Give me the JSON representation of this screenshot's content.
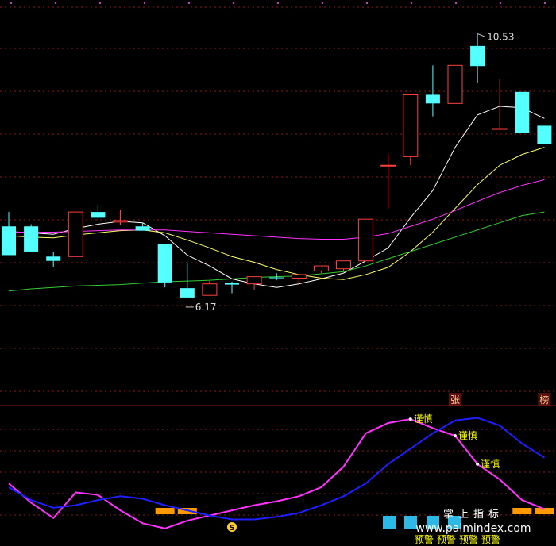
{
  "colors": {
    "background": "#000000",
    "grid": "#8b1a1a",
    "up_candle": "#ff4040",
    "down_candle": "#54ffff",
    "ma5": "#ffffff",
    "ma10": "#ffff66",
    "ma20": "#ff33ff",
    "ma60": "#33cc33",
    "osc_fast": "#ff33ff",
    "osc_slow": "#1f1fff",
    "signal_bar": "#ff9900",
    "caution_text": "#ffff00",
    "badge_bg": "#5a1010",
    "badge_text": "#ffcc99"
  },
  "chart_data": [
    {
      "type": "candlestick",
      "title": "",
      "ylim": [
        5.7,
        10.8
      ],
      "grid": true,
      "candles": [
        {
          "o": 7.85,
          "h": 8.05,
          "l": 7.45,
          "c": 7.45
        },
        {
          "o": 7.85,
          "h": 7.88,
          "l": 7.5,
          "c": 7.5
        },
        {
          "o": 7.43,
          "h": 7.5,
          "l": 7.28,
          "c": 7.37
        },
        {
          "o": 7.43,
          "h": 8.05,
          "l": 7.43,
          "c": 8.05
        },
        {
          "o": 8.05,
          "h": 8.15,
          "l": 7.94,
          "c": 7.97
        },
        {
          "o": 7.91,
          "h": 8.08,
          "l": 7.87,
          "c": 7.93
        },
        {
          "o": 7.85,
          "h": 7.9,
          "l": 7.8,
          "c": 7.79
        },
        {
          "o": 7.6,
          "h": 7.6,
          "l": 7.0,
          "c": 7.07
        },
        {
          "o": 6.99,
          "h": 7.35,
          "l": 6.85,
          "c": 6.86
        },
        {
          "o": 6.89,
          "h": 7.09,
          "l": 6.89,
          "c": 7.05
        },
        {
          "o": 7.06,
          "h": 7.08,
          "l": 6.92,
          "c": 7.04
        },
        {
          "o": 7.05,
          "h": 7.15,
          "l": 6.97,
          "c": 7.15
        },
        {
          "o": 7.14,
          "h": 7.2,
          "l": 7.1,
          "c": 7.13
        },
        {
          "o": 7.13,
          "h": 7.14,
          "l": 7.05,
          "c": 7.18
        },
        {
          "o": 7.23,
          "h": 7.3,
          "l": 7.2,
          "c": 7.3
        },
        {
          "o": 7.26,
          "h": 7.37,
          "l": 7.23,
          "c": 7.37
        },
        {
          "o": 7.37,
          "h": 7.37,
          "l": 7.37,
          "c": 7.95
        },
        {
          "o": 8.7,
          "h": 8.85,
          "l": 8.1,
          "c": 8.7
        },
        {
          "o": 8.82,
          "h": 9.68,
          "l": 8.7,
          "c": 9.68
        },
        {
          "o": 9.68,
          "h": 10.09,
          "l": 9.38,
          "c": 9.56
        },
        {
          "o": 9.56,
          "h": 10.09,
          "l": 9.56,
          "c": 10.09
        },
        {
          "o": 10.36,
          "h": 10.53,
          "l": 9.85,
          "c": 10.08
        },
        {
          "o": 9.2,
          "h": 9.9,
          "l": 9.2,
          "c": 9.21
        },
        {
          "o": 9.72,
          "h": 9.72,
          "l": 9.15,
          "c": 9.15
        },
        {
          "o": 9.25,
          "h": 9.25,
          "l": 9.0,
          "c": 9.0
        }
      ],
      "moving_averages": [
        {
          "name": "MA5",
          "values": [
            7.78,
            7.76,
            7.74,
            7.82,
            7.88,
            7.92,
            7.9,
            7.72,
            7.45,
            7.3,
            7.12,
            7.05,
            7.0,
            7.05,
            7.12,
            7.2,
            7.37,
            7.55,
            7.97,
            8.35,
            8.95,
            9.4,
            9.52,
            9.5,
            9.35
          ]
        },
        {
          "name": "MA10",
          "values": [
            7.72,
            7.7,
            7.69,
            7.73,
            7.76,
            7.79,
            7.8,
            7.76,
            7.66,
            7.55,
            7.43,
            7.35,
            7.25,
            7.18,
            7.13,
            7.11,
            7.18,
            7.28,
            7.5,
            7.77,
            8.1,
            8.43,
            8.7,
            8.85,
            8.95
          ]
        },
        {
          "name": "MA20",
          "values": [
            7.77,
            7.77,
            7.77,
            7.78,
            7.79,
            7.8,
            7.8,
            7.8,
            7.78,
            7.76,
            7.74,
            7.72,
            7.7,
            7.68,
            7.67,
            7.67,
            7.7,
            7.75,
            7.85,
            7.95,
            8.07,
            8.2,
            8.32,
            8.42,
            8.5
          ]
        },
        {
          "name": "MA60",
          "values": [
            6.95,
            6.98,
            7.0,
            7.02,
            7.03,
            7.04,
            7.06,
            7.08,
            7.09,
            7.1,
            7.12,
            7.14,
            7.15,
            7.16,
            7.19,
            7.22,
            7.3,
            7.4,
            7.5,
            7.6,
            7.7,
            7.8,
            7.9,
            8.0,
            8.05
          ]
        }
      ],
      "annotations": [
        {
          "text": "10.53",
          "candle": 21,
          "price": 10.53
        },
        {
          "text": "6.17",
          "candle": 8,
          "price": 6.86
        }
      ],
      "badges": [
        {
          "text": "张",
          "candle": 20
        },
        {
          "text": "榜",
          "candle": 24
        }
      ]
    },
    {
      "type": "line",
      "title": "",
      "ylim": [
        0,
        100
      ],
      "series": [
        {
          "name": "",
          "values": [
            45,
            30,
            18,
            38,
            36,
            24,
            14,
            10,
            16,
            20,
            24,
            28,
            31,
            35,
            42,
            58,
            84,
            92,
            95,
            88,
            82,
            60,
            48,
            32,
            25
          ]
        },
        {
          "name": "",
          "values": [
            42,
            32,
            26,
            28,
            32,
            35,
            33,
            28,
            24,
            20,
            17,
            17,
            19,
            22,
            28,
            35,
            45,
            60,
            72,
            84,
            94,
            96,
            90,
            76,
            65
          ]
        }
      ],
      "caution_labels": [
        {
          "text": "谨慎",
          "index": 18
        },
        {
          "text": "谨慎",
          "index": 20
        },
        {
          "text": "谨慎",
          "index": 21
        }
      ],
      "signal_bars": [
        {
          "index": 7,
          "value": 20
        },
        {
          "index": 8,
          "value": 20
        },
        {
          "index": 23,
          "value": 20
        },
        {
          "index": 24,
          "value": 20
        }
      ],
      "marker_s": {
        "text": "S",
        "index": 10
      },
      "watermark_title": "掌上指标",
      "watermark_url": "www.palmindex.com",
      "warning_labels": [
        "预警",
        "预警",
        "预警",
        "预警"
      ]
    }
  ]
}
